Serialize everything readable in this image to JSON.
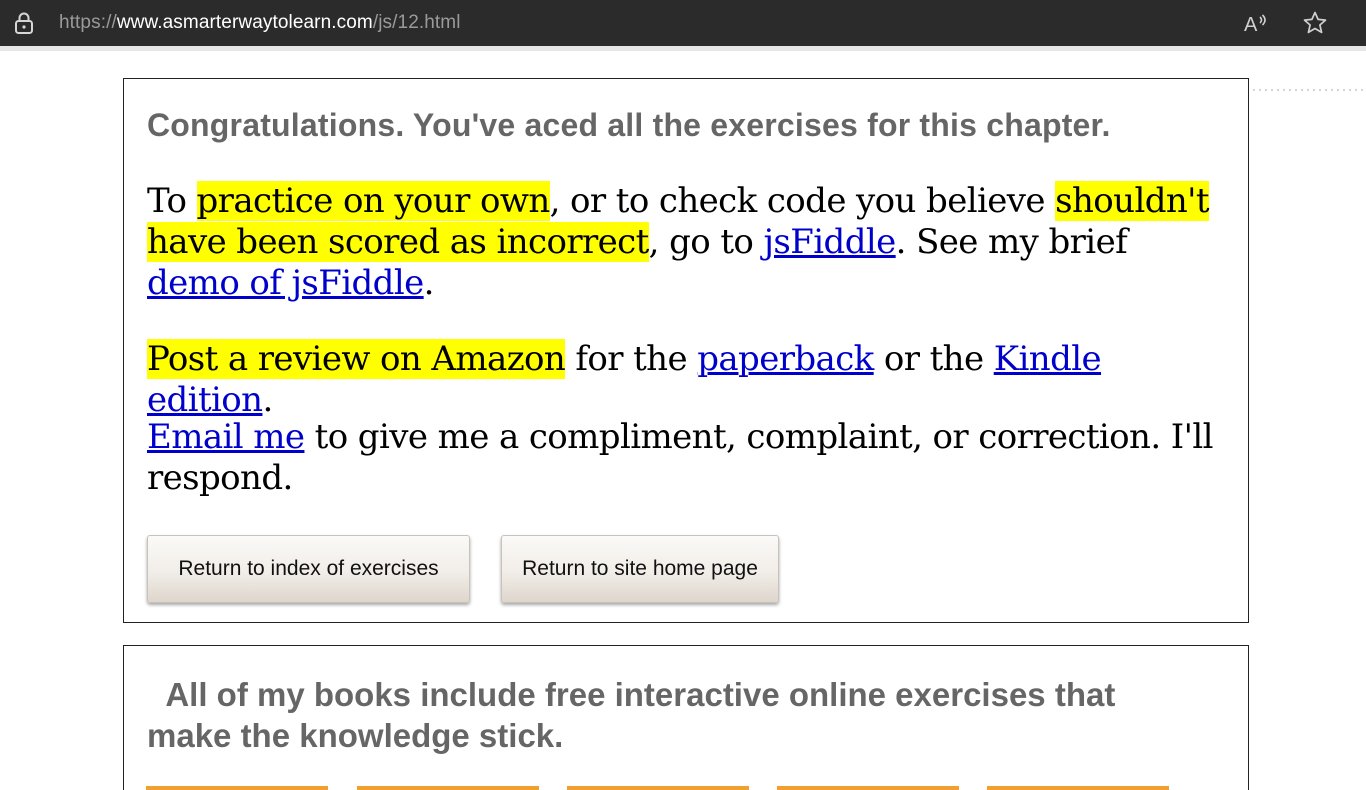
{
  "browser": {
    "url_scheme": "https://",
    "url_host": "www.asmarterwaytolearn.com",
    "url_path": "/js/12.html",
    "icons": [
      "lock-icon",
      "read-aloud-icon",
      "favorite-star-icon"
    ]
  },
  "main": {
    "congrats": "Congratulations. You've aced all the exercises for this chapter.",
    "p1": {
      "t1": "To ",
      "hl1": "practice on your own",
      "t2": ", or to check code you believe ",
      "hl2": "shouldn't have been scored as incorrect",
      "t3": ", go to ",
      "link1": "jsFiddle",
      "t4": ". See my brief ",
      "link2": "demo of jsFiddle",
      "t5": "."
    },
    "p2": {
      "hl": "Post a review on Amazon",
      "t1": " for the ",
      "link1": "paperback",
      "t2": " or the ",
      "link2": "Kindle edition",
      "t3": "."
    },
    "p3": {
      "link": "Email me",
      "t1": " to give me a compliment, complaint, or correction. I'll respond."
    },
    "buttons": {
      "index": "Return to index of exercises",
      "home": "Return to site home page"
    }
  },
  "books": {
    "heading": "All of my books include free interactive online exercises that make the knowledge stick."
  },
  "colors": {
    "highlight": "#ffff00",
    "link": "#0000cc",
    "heading_gray": "#666666",
    "address_bar": "#2b2b2b",
    "book_tab": "#f0a030"
  }
}
